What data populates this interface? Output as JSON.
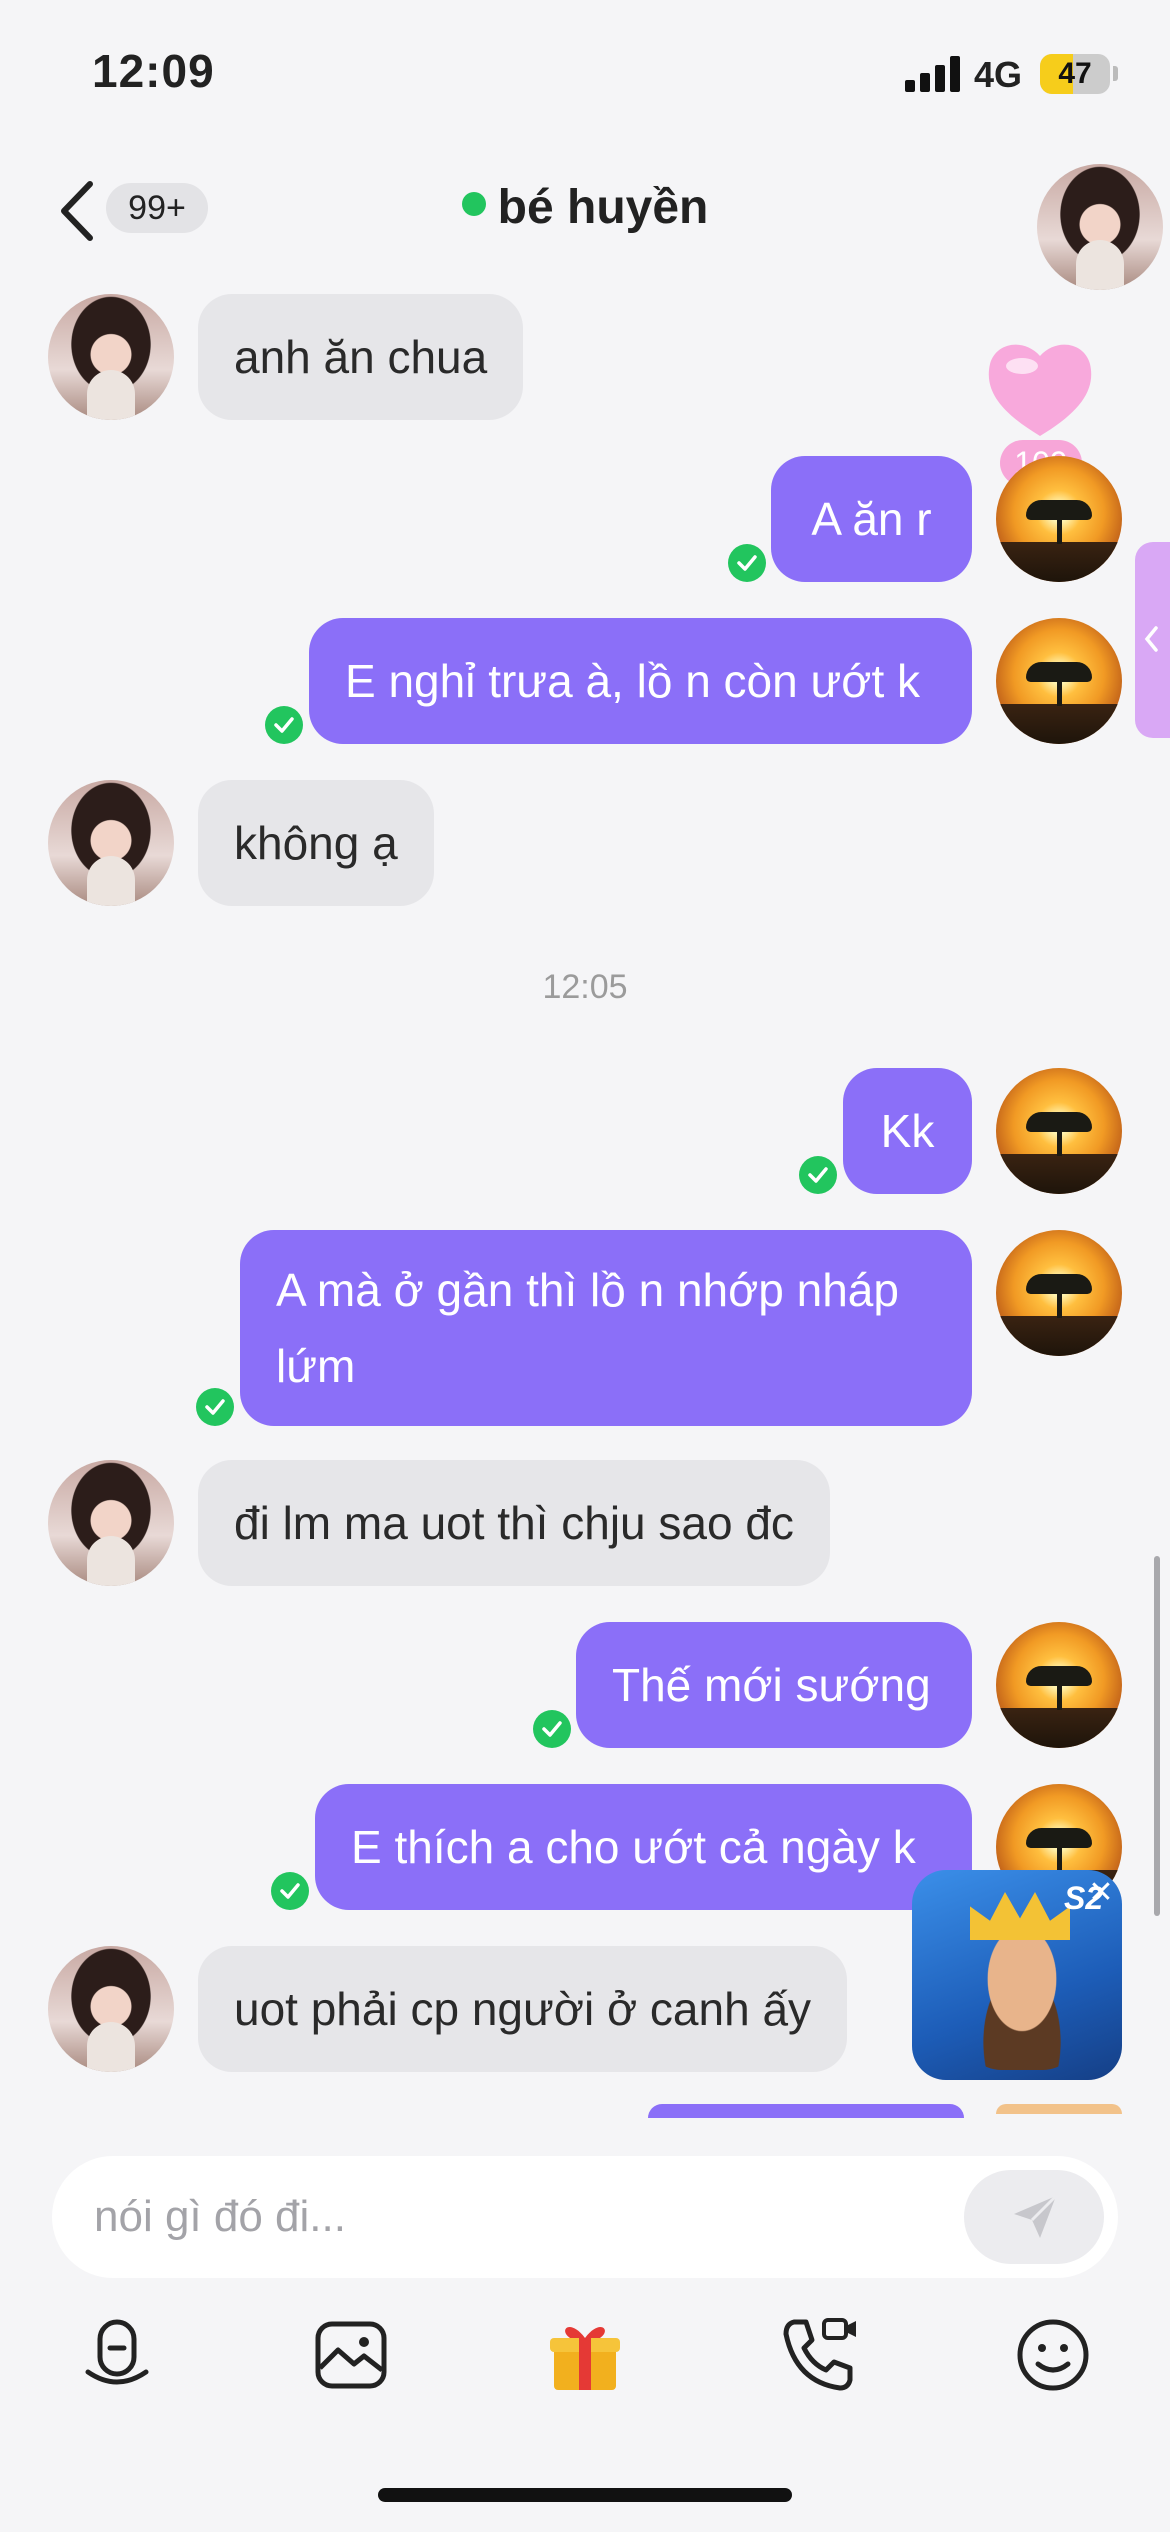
{
  "status_bar": {
    "time": "12:09",
    "network": "4G",
    "battery": "47",
    "battery_level": 0.47
  },
  "header": {
    "unread_count": "99+",
    "contact_name": "bé huyền",
    "online": true
  },
  "reaction": {
    "count": "109"
  },
  "timestamp_divider": "12:05",
  "messages": [
    {
      "dir": "in",
      "text": "anh ăn chua"
    },
    {
      "dir": "out",
      "text": "A ăn r"
    },
    {
      "dir": "out",
      "text": "E nghỉ trưa à, lồ n còn ướt k"
    },
    {
      "dir": "in",
      "text": "không ạ"
    },
    {
      "dir": "out",
      "text": "Kk"
    },
    {
      "dir": "out",
      "text": "A mà ở gần thì lồ n nhớp nháp lứm"
    },
    {
      "dir": "in",
      "text": "đi lm ma uot thì chju sao đc"
    },
    {
      "dir": "out",
      "text": "Thế mới sướng"
    },
    {
      "dir": "out",
      "text": "E thích a cho ướt cả ngày k"
    },
    {
      "dir": "in",
      "text": "uot phải cp người ở canh ấy"
    }
  ],
  "input": {
    "placeholder": "nói gì đó đi..."
  },
  "game_ad": {
    "tag": "S2"
  },
  "toolbar": {
    "icons": [
      "voice-icon",
      "image-icon",
      "gift-icon",
      "video-call-icon",
      "emoji-icon"
    ]
  },
  "colors": {
    "outgoing_bubble": "#8b6ff8",
    "incoming_bubble": "#e6e6e9",
    "online": "#22c55e",
    "battery": "#f6cd1b"
  }
}
